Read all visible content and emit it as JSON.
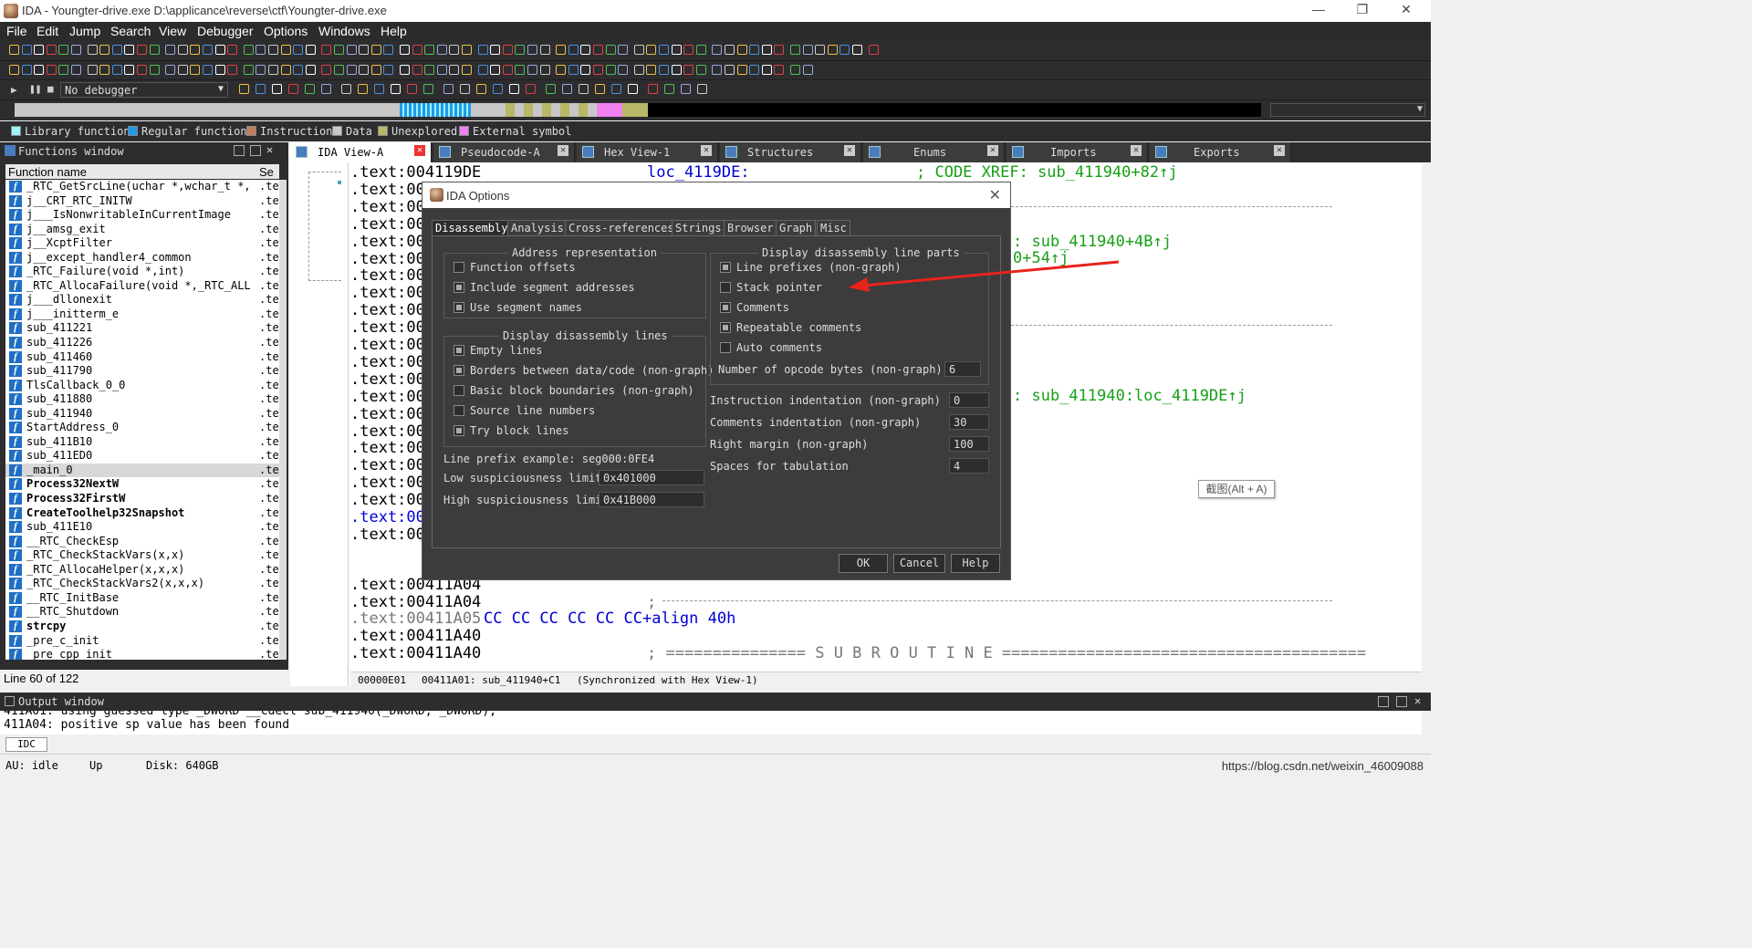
{
  "window": {
    "title": "IDA - Youngter-drive.exe D:\\applicance\\reverse\\ctf\\Youngter-drive.exe",
    "minimize": "—",
    "restore": "❐",
    "close": "✕"
  },
  "menu": [
    "File",
    "Edit",
    "Jump",
    "Search",
    "View",
    "Debugger",
    "Options",
    "Windows",
    "Help"
  ],
  "debugger_select": "No debugger",
  "legend": [
    {
      "label": "Library function",
      "color": "#a0f0ff"
    },
    {
      "label": "Regular function",
      "color": "#1e9be8"
    },
    {
      "label": "Instruction",
      "color": "#c08060"
    },
    {
      "label": "Data",
      "color": "#c8c8c8"
    },
    {
      "label": "Unexplored",
      "color": "#b8b868"
    },
    {
      "label": "External symbol",
      "color": "#f080f0"
    }
  ],
  "functions_window": {
    "title": "Functions window",
    "col_name": "Function name",
    "col_seg": "Se",
    "status": "Line 60 of 122",
    "items": [
      {
        "name": "_RTC_GetSrcLine(uchar *,wchar_t *,u…",
        "seg": ".te"
      },
      {
        "name": "j__CRT_RTC_INITW",
        "seg": ".te"
      },
      {
        "name": "j___IsNonwritableInCurrentImage",
        "seg": ".te"
      },
      {
        "name": "j__amsg_exit",
        "seg": ".te"
      },
      {
        "name": "j__XcptFilter",
        "seg": ".te"
      },
      {
        "name": "j__except_handler4_common",
        "seg": ".te"
      },
      {
        "name": "_RTC_Failure(void *,int)",
        "seg": ".te"
      },
      {
        "name": "_RTC_AllocaFailure(void *,_RTC_ALLO…",
        "seg": ".te"
      },
      {
        "name": "j___dllonexit",
        "seg": ".te"
      },
      {
        "name": "j___initterm_e",
        "seg": ".te"
      },
      {
        "name": "sub_411221",
        "seg": ".te"
      },
      {
        "name": "sub_411226",
        "seg": ".te"
      },
      {
        "name": "sub_411460",
        "seg": ".te"
      },
      {
        "name": "sub_411790",
        "seg": ".te"
      },
      {
        "name": "TlsCallback_0_0",
        "seg": ".te"
      },
      {
        "name": "sub_411880",
        "seg": ".te"
      },
      {
        "name": "sub_411940",
        "seg": ".te"
      },
      {
        "name": "StartAddress_0",
        "seg": ".te"
      },
      {
        "name": "sub_411B10",
        "seg": ".te"
      },
      {
        "name": "sub_411ED0",
        "seg": ".te"
      },
      {
        "name": "_main_0",
        "seg": ".te"
      },
      {
        "name": "Process32NextW",
        "seg": ".te"
      },
      {
        "name": "Process32FirstW",
        "seg": ".te"
      },
      {
        "name": "CreateToolhelp32Snapshot",
        "seg": ".te"
      },
      {
        "name": "sub_411E10",
        "seg": ".te"
      },
      {
        "name": "__RTC_CheckEsp",
        "seg": ".te"
      },
      {
        "name": "_RTC_CheckStackVars(x,x)",
        "seg": ".te"
      },
      {
        "name": "_RTC_AllocaHelper(x,x,x)",
        "seg": ".te"
      },
      {
        "name": "_RTC_CheckStackVars2(x,x,x)",
        "seg": ".te"
      },
      {
        "name": "__RTC_InitBase",
        "seg": ".te"
      },
      {
        "name": "__RTC_Shutdown",
        "seg": ".te"
      },
      {
        "name": "strcpy",
        "seg": ".te"
      },
      {
        "name": "_pre_c_init",
        "seg": ".te"
      },
      {
        "name": "_pre_cpp_init",
        "seg": ".te"
      }
    ]
  },
  "tabs": [
    "IDA View-A",
    "Pseudocode-A",
    "Hex View-1",
    "Structures",
    "Enums",
    "Imports",
    "Exports"
  ],
  "code": {
    "line0_addr": ".text:004119DE",
    "line0_label": "loc_4119DE:",
    "line0_comment": "; CODE XREF: sub_411940+82↑j",
    "partial_addr": ".text:00",
    "xref1": ": sub_411940+4B↑j",
    "xref2": "0+54↑j",
    "xref3": ": sub_411940:loc_4119DE↑j",
    "a04_1": ".text:00411A04",
    "a04_2": ".text:00411A04",
    "a04_sep": ";",
    "a05_addr": ".text:00411A05",
    "a05_bytes": "CC CC CC CC CC CC+align 40h",
    "a40_1": ".text:00411A40",
    "a40_2": ".text:00411A40",
    "subroutine": "; =============== S U B R O U T I N E ======================================="
  },
  "code_status": {
    "offset": "00000E01",
    "loc": "00411A01: sub_411940+C1",
    "sync": "(Synchronized with Hex View-1)"
  },
  "dialog": {
    "title": "IDA Options",
    "tabs": [
      "Disassembly",
      "Analysis",
      "Cross-references",
      "Strings",
      "Browser",
      "Graph",
      "Misc"
    ],
    "addr_group": "Address representation",
    "addr_opts": [
      {
        "label": "Function offsets",
        "checked": false
      },
      {
        "label": "Include segment addresses",
        "checked": true
      },
      {
        "label": "Use segment names",
        "checked": true
      }
    ],
    "lines_group": "Display disassembly lines",
    "lines_opts": [
      {
        "label": "Empty lines",
        "checked": true
      },
      {
        "label": "Borders between data/code (non-graph)",
        "checked": true
      },
      {
        "label": "Basic block boundaries (non-graph)",
        "checked": false
      },
      {
        "label": "Source line numbers",
        "checked": false
      },
      {
        "label": "Try block lines",
        "checked": true
      }
    ],
    "parts_group": "Display disassembly line parts",
    "parts_opts": [
      {
        "label": "Line prefixes (non-graph)",
        "checked": true
      },
      {
        "label": "Stack pointer",
        "checked": false
      },
      {
        "label": "Comments",
        "checked": true
      },
      {
        "label": "Repeatable comments",
        "checked": true
      },
      {
        "label": "Auto comments",
        "checked": false
      }
    ],
    "opcode_label": "Number of opcode bytes (non-graph)",
    "opcode_value": "6",
    "prefix_example": "Line prefix example: seg000:0FE4",
    "low_label": "Low suspiciousness limit",
    "low_value": "0x401000",
    "high_label": "High suspiciousness limit",
    "high_value": "0x41B000",
    "instr_indent_label": "Instruction indentation (non-graph)",
    "instr_indent_value": "0",
    "comm_indent_label": "Comments indentation (non-graph)",
    "comm_indent_value": "30",
    "margin_label": "Right margin (non-graph)",
    "margin_value": "100",
    "tab_label": "Spaces for tabulation",
    "tab_value": "4",
    "ok": "OK",
    "cancel": "Cancel",
    "help": "Help"
  },
  "tooltip": "截图(Alt + A)",
  "output": {
    "title": "Output window",
    "line1": "411A01: using guessed type _DWORD __cdecl sub_411940(_DWORD, _DWORD);",
    "line2": "411A04: positive sp value has been found",
    "idc": "IDC"
  },
  "status": {
    "au": "AU:  idle",
    "dir": "Up",
    "disk": "Disk: 640GB",
    "watermark": "https://blog.csdn.net/weixin_46009088"
  }
}
